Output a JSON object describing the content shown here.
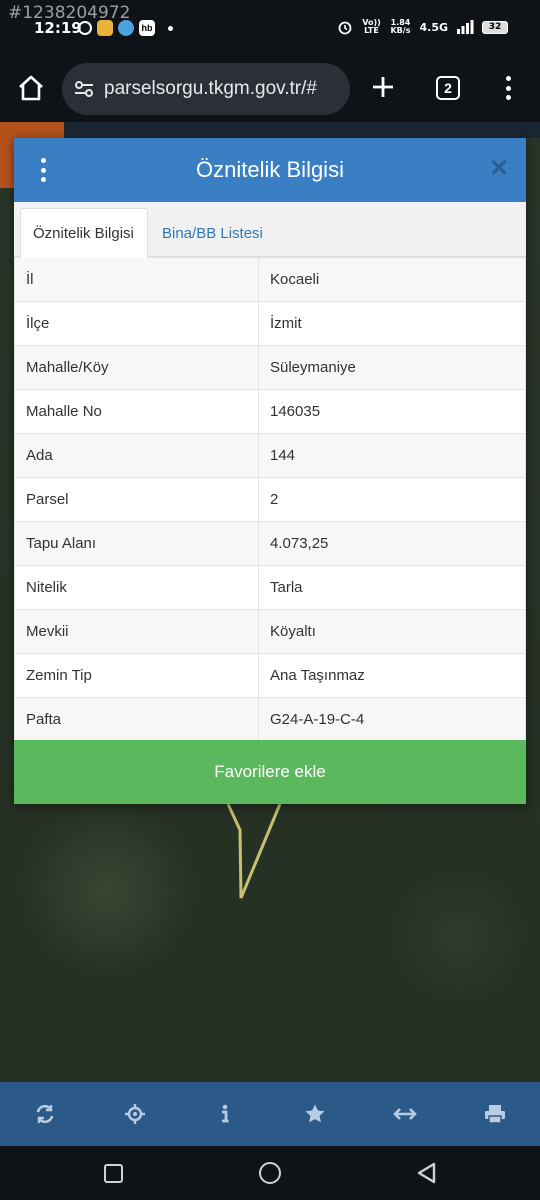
{
  "status_bar": {
    "watermark": "#1238204972",
    "time": "12:19",
    "volte": "Vo)) LTE",
    "speed": "1.84 KB/s",
    "network": "4.5G",
    "battery": "32"
  },
  "browser": {
    "url": "parselsorgu.tkgm.gov.tr/#",
    "tab_count": "2"
  },
  "dialog": {
    "title": "Öznitelik Bilgisi",
    "close_glyph": "✕",
    "tabs": [
      {
        "label": "Öznitelik Bilgisi",
        "active": true
      },
      {
        "label": "Bina/BB Listesi",
        "active": false
      }
    ],
    "rows": [
      {
        "label": "İl",
        "value": "Kocaeli"
      },
      {
        "label": "İlçe",
        "value": "İzmit"
      },
      {
        "label": "Mahalle/Köy",
        "value": "Süleymaniye"
      },
      {
        "label": "Mahalle No",
        "value": "146035"
      },
      {
        "label": "Ada",
        "value": "144"
      },
      {
        "label": "Parsel",
        "value": "2"
      },
      {
        "label": "Tapu Alanı",
        "value": "4.073,25"
      },
      {
        "label": "Nitelik",
        "value": "Tarla"
      },
      {
        "label": "Mevkii",
        "value": "Köyaltı"
      },
      {
        "label": "Zemin Tip",
        "value": "Ana Taşınmaz"
      },
      {
        "label": "Pafta",
        "value": "G24-A-19-C-4"
      }
    ],
    "favorite_button": "Favorilere ekle"
  },
  "map_toolbar": {
    "tools": [
      "refresh-icon",
      "locate-icon",
      "info-icon",
      "star-icon",
      "measure-icon",
      "print-icon"
    ]
  },
  "colors": {
    "header_blue": "#3a7fc3",
    "favorite_green": "#5cb85c",
    "toolbar_blue": "#2c5a88",
    "tab_link_blue": "#2f78b8"
  }
}
